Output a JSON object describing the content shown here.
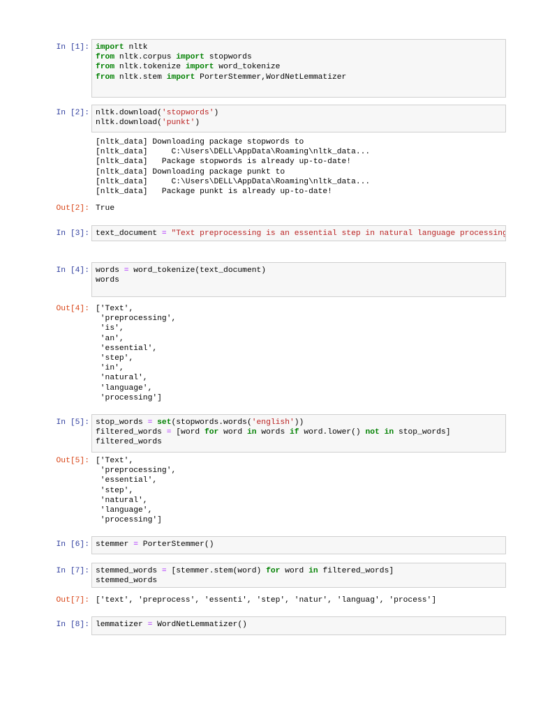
{
  "cells": [
    {
      "prompt": "In [1]:",
      "code": [
        [
          [
            "import",
            "kw"
          ],
          [
            " nltk",
            ""
          ]
        ],
        [
          [
            "from",
            "kw"
          ],
          [
            " nltk.corpus ",
            ""
          ],
          [
            "import",
            "kw"
          ],
          [
            " stopwords",
            ""
          ]
        ],
        [
          [
            "from",
            "kw"
          ],
          [
            " nltk.tokenize ",
            ""
          ],
          [
            "import",
            "kw"
          ],
          [
            " word_tokenize",
            ""
          ]
        ],
        [
          [
            "from",
            "kw"
          ],
          [
            " nltk.stem ",
            ""
          ],
          [
            "import",
            "kw"
          ],
          [
            " PorterStemmer,WordNetLemmatizer",
            ""
          ]
        ]
      ]
    },
    {
      "prompt": "In [2]:",
      "code": [
        [
          [
            "nltk.download(",
            ""
          ],
          [
            "'stopwords'",
            "str"
          ],
          [
            ")",
            ""
          ]
        ],
        [
          [
            "nltk.download(",
            ""
          ],
          [
            "'punkt'",
            "str"
          ],
          [
            ")",
            ""
          ]
        ]
      ],
      "stream": [
        "[nltk_data] Downloading package stopwords to",
        "[nltk_data]     C:\\Users\\DELL\\AppData\\Roaming\\nltk_data...",
        "[nltk_data]   Package stopwords is already up-to-date!",
        "[nltk_data] Downloading package punkt to",
        "[nltk_data]     C:\\Users\\DELL\\AppData\\Roaming\\nltk_data...",
        "[nltk_data]   Package punkt is already up-to-date!"
      ],
      "out_prompt": "Out[2]:",
      "out": [
        "True"
      ]
    },
    {
      "prompt": "In [3]:",
      "code": [
        [
          [
            "text_document ",
            ""
          ],
          [
            "=",
            "op"
          ],
          [
            " ",
            ""
          ],
          [
            "\"Text preprocessing is an essential step in natural language processing",
            "str"
          ]
        ]
      ]
    },
    {
      "prompt": "In [4]:",
      "code": [
        [
          [
            "words ",
            ""
          ],
          [
            "=",
            "op"
          ],
          [
            " word_tokenize(text_document)",
            ""
          ]
        ],
        [
          [
            "words",
            ""
          ]
        ]
      ],
      "out_prompt": "Out[4]:",
      "out": [
        "['Text',",
        " 'preprocessing',",
        " 'is',",
        " 'an',",
        " 'essential',",
        " 'step',",
        " 'in',",
        " 'natural',",
        " 'language',",
        " 'processing']"
      ]
    },
    {
      "prompt": "In [5]:",
      "code": [
        [
          [
            "stop_words ",
            ""
          ],
          [
            "=",
            "op"
          ],
          [
            " ",
            ""
          ],
          [
            "set",
            "kw"
          ],
          [
            "(stopwords.words(",
            ""
          ],
          [
            "'english'",
            "str"
          ],
          [
            "))",
            ""
          ]
        ],
        [
          [
            "filtered_words ",
            ""
          ],
          [
            "=",
            "op"
          ],
          [
            " [word ",
            ""
          ],
          [
            "for",
            "kw"
          ],
          [
            " word ",
            ""
          ],
          [
            "in",
            "kw"
          ],
          [
            " words ",
            ""
          ],
          [
            "if",
            "kw"
          ],
          [
            " word.lower() ",
            ""
          ],
          [
            "not",
            "kw"
          ],
          [
            " ",
            ""
          ],
          [
            "in",
            "kw"
          ],
          [
            " stop_words]",
            ""
          ]
        ],
        [
          [
            "filtered_words",
            ""
          ]
        ]
      ],
      "out_prompt": "Out[5]:",
      "out": [
        "['Text',",
        " 'preprocessing',",
        " 'essential',",
        " 'step',",
        " 'natural',",
        " 'language',",
        " 'processing']"
      ]
    },
    {
      "prompt": "In [6]:",
      "code": [
        [
          [
            "stemmer ",
            ""
          ],
          [
            "=",
            "op"
          ],
          [
            " PorterStemmer()",
            ""
          ]
        ]
      ]
    },
    {
      "prompt": "In [7]:",
      "code": [
        [
          [
            "stemmed_words ",
            ""
          ],
          [
            "=",
            "op"
          ],
          [
            " [stemmer.stem(word) ",
            ""
          ],
          [
            "for",
            "kw"
          ],
          [
            " word ",
            ""
          ],
          [
            "in",
            "kw"
          ],
          [
            " filtered_words]",
            ""
          ]
        ],
        [
          [
            "stemmed_words",
            ""
          ]
        ]
      ],
      "out_prompt": "Out[7]:",
      "out": [
        "['text', 'preprocess', 'essenti', 'step', 'natur', 'languag', 'process']"
      ]
    },
    {
      "prompt": "In [8]:",
      "code": [
        [
          [
            "lemmatizer ",
            ""
          ],
          [
            "=",
            "op"
          ],
          [
            " WordNetLemmatizer()",
            ""
          ]
        ]
      ]
    }
  ]
}
